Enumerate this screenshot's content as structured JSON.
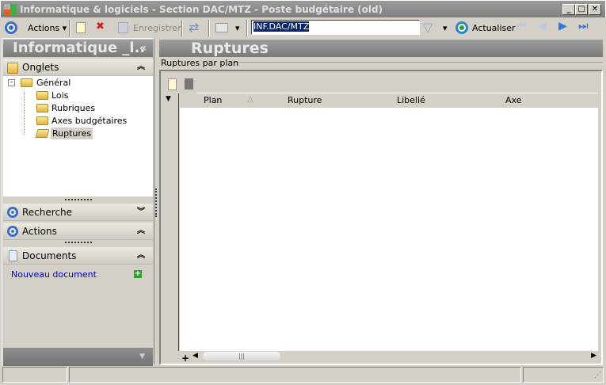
{
  "window": {
    "title": "Informatique & logiciels - Section DAC/MTZ - Poste budgétaire (old)"
  },
  "toolbar": {
    "actions": "Actions",
    "save": "Enregistrer",
    "search_value": "INF.DAC/MTZ",
    "refresh": "Actualiser"
  },
  "left": {
    "header": "Informatique _l..",
    "collapse": "«",
    "onglets": "Onglets",
    "tree": {
      "root": "Général",
      "children": [
        "Lois",
        "Rubriques",
        "Axes budgétaires",
        "Ruptures"
      ]
    },
    "recherche": "Recherche",
    "actions": "Actions",
    "documents": "Documents",
    "new_doc": "Nouveau document"
  },
  "main": {
    "header": "Ruptures",
    "group": "Ruptures par plan",
    "columns": [
      "Plan",
      "Rupture",
      "Libellé",
      "Axe"
    ]
  }
}
